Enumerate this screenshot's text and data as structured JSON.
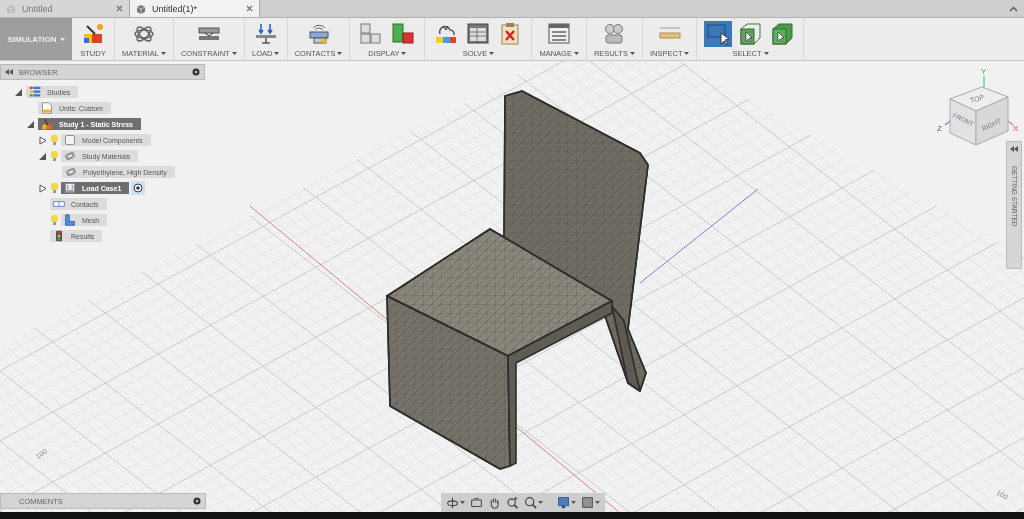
{
  "tabs": [
    {
      "label": "Untitled",
      "selected": false
    },
    {
      "label": "Untitled(1)*",
      "selected": true
    }
  ],
  "toolbar": {
    "workspace": {
      "label": "SIMULATION",
      "menu": true
    },
    "groups": [
      {
        "label": "STUDY",
        "menu": false,
        "tools": [
          {
            "kind": "study",
            "selected": false
          }
        ]
      },
      {
        "label": "MATERIAL",
        "menu": true,
        "tools": [
          {
            "kind": "material",
            "selected": false
          }
        ]
      },
      {
        "label": "CONSTRAINT",
        "menu": true,
        "tools": [
          {
            "kind": "constraint",
            "selected": false
          }
        ]
      },
      {
        "label": "LOAD",
        "menu": true,
        "tools": [
          {
            "kind": "load",
            "selected": false
          }
        ]
      },
      {
        "label": "CONTACTS",
        "menu": true,
        "tools": [
          {
            "kind": "contacts",
            "selected": false
          }
        ]
      },
      {
        "label": "DISPLAY",
        "menu": true,
        "tools": [
          {
            "kind": "display-blocks",
            "selected": false
          },
          {
            "kind": "display-colors",
            "selected": false
          }
        ]
      },
      {
        "label": "SOLVE",
        "menu": true,
        "tools": [
          {
            "kind": "solve-cloud",
            "selected": false
          },
          {
            "kind": "solve-table",
            "selected": false
          },
          {
            "kind": "solve-cancel",
            "selected": false
          }
        ]
      },
      {
        "label": "MANAGE",
        "menu": true,
        "tools": [
          {
            "kind": "manage",
            "selected": false
          }
        ]
      },
      {
        "label": "RESULTS",
        "menu": true,
        "tools": [
          {
            "kind": "results",
            "selected": false
          }
        ]
      },
      {
        "label": "INSPECT",
        "menu": true,
        "tools": [
          {
            "kind": "inspect",
            "selected": false
          }
        ]
      },
      {
        "label": "SELECT",
        "menu": true,
        "tools": [
          {
            "kind": "select-window",
            "selected": true
          },
          {
            "kind": "select-box",
            "selected": false
          },
          {
            "kind": "select-solid",
            "selected": false
          }
        ]
      }
    ]
  },
  "browser": {
    "title": "BROWSER",
    "tree": [
      {
        "label": "Studies",
        "kind": "studies",
        "expanded": true,
        "active": false,
        "children": [
          {
            "label": "Units: Custom",
            "kind": "document",
            "active": false
          },
          {
            "label": "Study 1 - Static Stress",
            "kind": "study",
            "expanded": true,
            "active": true,
            "children": [
              {
                "label": "Model Components",
                "kind": "component",
                "bulb": true,
                "expanded": false,
                "active": false
              },
              {
                "label": "Study Materials",
                "kind": "material",
                "bulb": true,
                "expanded": true,
                "active": false,
                "children": [
                  {
                    "label": "Polyethylene, High Density",
                    "kind": "material",
                    "active": false
                  }
                ]
              },
              {
                "label": "Load Case1",
                "kind": "load",
                "bulb": true,
                "expanded": false,
                "active": true,
                "target": true
              },
              {
                "label": "Contacts",
                "kind": "contacts",
                "active": false
              },
              {
                "label": "Mesh",
                "kind": "mesh",
                "bulb": true,
                "active": false
              },
              {
                "label": "Results",
                "kind": "results",
                "active": false
              }
            ]
          }
        ]
      }
    ]
  },
  "view_cube": {
    "faces": [
      "TOP",
      "FRONT",
      "RIGHT"
    ],
    "axes": [
      "Y",
      "Z",
      "X"
    ]
  },
  "grid_labels": [
    "100",
    "100"
  ],
  "side_panel": {
    "label": "GETTING STARTED"
  },
  "comments": {
    "title": "COMMENTS"
  },
  "nav_bar": {
    "groups": [
      {
        "buttons": [
          {
            "kind": "orbit",
            "menu": true
          },
          {
            "kind": "look-at",
            "menu": false
          },
          {
            "kind": "pan",
            "menu": false
          },
          {
            "kind": "zoom-window",
            "menu": false
          },
          {
            "kind": "zoom",
            "menu": true
          }
        ]
      },
      {
        "buttons": [
          {
            "kind": "display",
            "menu": true
          },
          {
            "kind": "grid",
            "menu": true
          }
        ]
      }
    ]
  }
}
